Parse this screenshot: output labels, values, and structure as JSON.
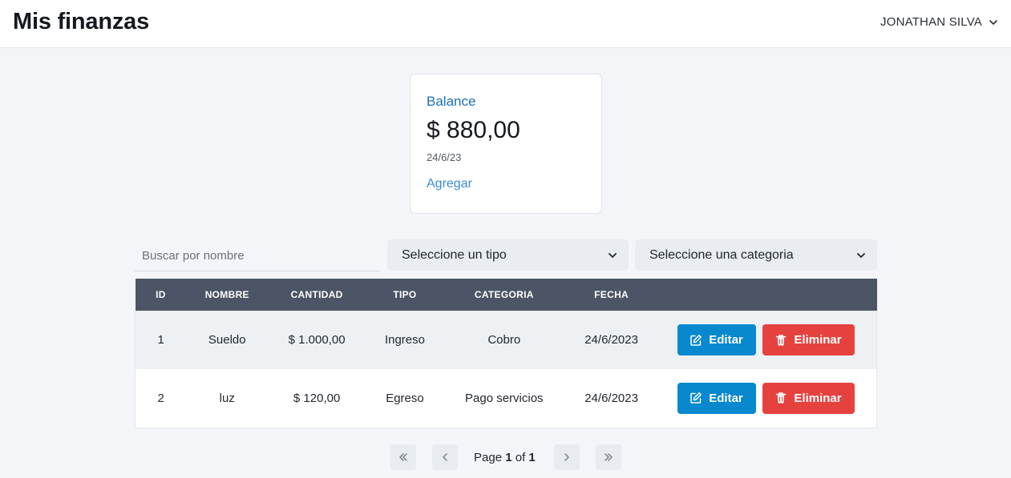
{
  "header": {
    "title": "Mis finanzas",
    "user_name": "JONATHAN SILVA",
    "user_icon": "chevron-down-icon"
  },
  "balance": {
    "title": "Balance",
    "amount": "$ 880,00",
    "date": "24/6/23",
    "link": "Agregar"
  },
  "filters": {
    "search_placeholder": "Buscar por nombre",
    "type_select": "Seleccione un tipo",
    "category_select": "Seleccione una categoria"
  },
  "table": {
    "columns": [
      "ID",
      "NOMBRE",
      "CANTIDAD",
      "TIPO",
      "CATEGORIA",
      "FECHA",
      ""
    ],
    "rows": [
      {
        "id": "1",
        "nombre": "Sueldo",
        "cantidad": "$ 1.000,00",
        "tipo": "Ingreso",
        "categoria": "Cobro",
        "fecha": "24/6/2023"
      },
      {
        "id": "2",
        "nombre": "luz",
        "cantidad": "$ 120,00",
        "tipo": "Egreso",
        "categoria": "Pago servicios",
        "fecha": "24/6/2023"
      }
    ],
    "edit_label": "Editar",
    "delete_label": "Eliminar",
    "edit_icon": "edit-icon",
    "delete_icon": "trash-icon"
  },
  "pagination": {
    "page_word": "Page",
    "current": "1",
    "of_word": "of",
    "total": "1"
  },
  "colors": {
    "header_bg": "#4b5565",
    "edit_button": "#0788cf",
    "delete_button": "#e5423f",
    "link": "#3a8bd2",
    "balance_title": "#1d6fb8"
  }
}
